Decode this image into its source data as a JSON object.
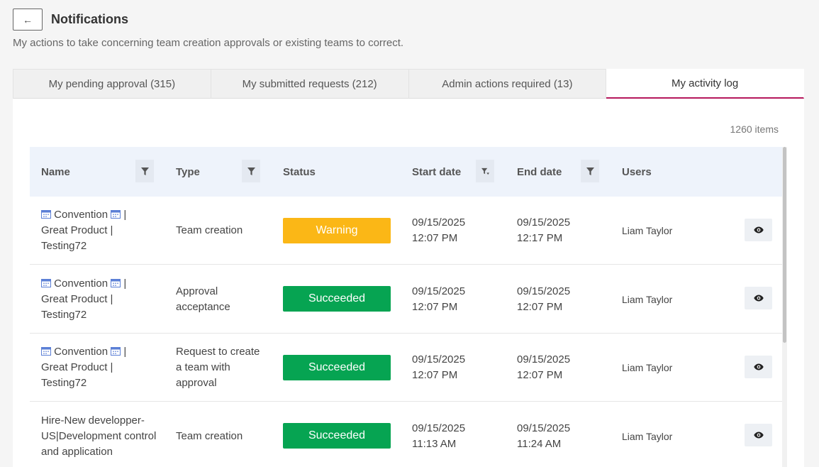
{
  "header": {
    "back_label": "←",
    "title": "Notifications",
    "subtitle": "My actions to take concerning team creation approvals or existing teams to correct."
  },
  "tabs": [
    {
      "label": "My pending approval (315)",
      "active": false
    },
    {
      "label": "My submitted requests (212)",
      "active": false
    },
    {
      "label": "Admin actions required (13)",
      "active": false
    },
    {
      "label": "My activity log",
      "active": true
    }
  ],
  "items_count": "1260 items",
  "columns": {
    "name": "Name",
    "type": "Type",
    "status": "Status",
    "start_date": "Start date",
    "end_date": "End date",
    "users": "Users"
  },
  "colors": {
    "accent": "#b5185c",
    "warning": "#fbb716",
    "success": "#06a452",
    "header_bg": "#eef3fb"
  },
  "rows": [
    {
      "name_line1": "Convention",
      "name_sep": "|",
      "name_line2": "Great Product |",
      "name_line3": "Testing72",
      "type_line1": "Team creation",
      "type_line2": "",
      "type_line3": "",
      "status": "Warning",
      "status_kind": "warning",
      "start_date": "09/15/2025",
      "start_time": "12:07 PM",
      "end_date": "09/15/2025",
      "end_time": "12:17 PM",
      "user": "Liam Taylor"
    },
    {
      "name_line1": "Convention",
      "name_sep": "|",
      "name_line2": "Great Product |",
      "name_line3": "Testing72",
      "type_line1": "Approval",
      "type_line2": "acceptance",
      "type_line3": "",
      "status": "Succeeded",
      "status_kind": "success",
      "start_date": "09/15/2025",
      "start_time": "12:07 PM",
      "end_date": "09/15/2025",
      "end_time": "12:07 PM",
      "user": "Liam Taylor"
    },
    {
      "name_line1": "Convention",
      "name_sep": "|",
      "name_line2": "Great Product |",
      "name_line3": "Testing72",
      "type_line1": "Request to create",
      "type_line2": "a team with",
      "type_line3": "approval",
      "status": "Succeeded",
      "status_kind": "success",
      "start_date": "09/15/2025",
      "start_time": "12:07 PM",
      "end_date": "09/15/2025",
      "end_time": "12:07 PM",
      "user": "Liam Taylor"
    },
    {
      "name_line1": "Hire-New developper-",
      "name_sep": "",
      "name_line2": "US|Development control",
      "name_line3": "and application",
      "type_line1": "Team creation",
      "type_line2": "",
      "type_line3": "",
      "status": "Succeeded",
      "status_kind": "success",
      "start_date": "09/15/2025",
      "start_time": "11:13 AM",
      "end_date": "09/15/2025",
      "end_time": "11:24 AM",
      "user": "Liam Taylor"
    }
  ]
}
